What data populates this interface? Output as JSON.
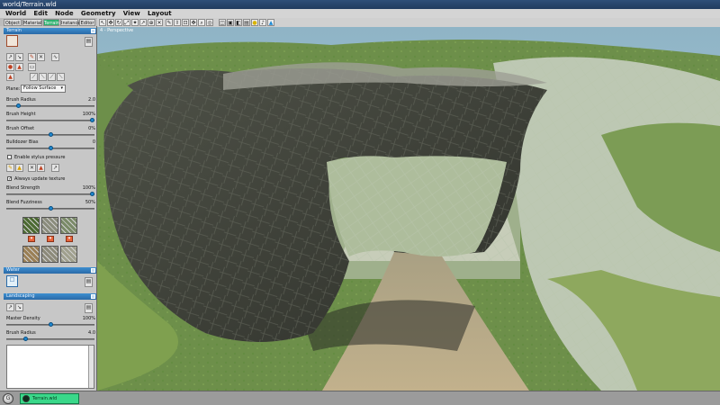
{
  "window": {
    "title": "world/Terrain.wld"
  },
  "menu": [
    "World",
    "Edit",
    "Node",
    "Geometry",
    "View",
    "Layout"
  ],
  "tabs": [
    "Object",
    "Material",
    "Terrain",
    "Instance",
    "Editor"
  ],
  "active_tab": "Terrain",
  "toolbar": {
    "icons": [
      "select-icon",
      "move-icon",
      "rotate-icon",
      "scale-icon",
      "magic-icon",
      "pointer-icon",
      "zoom-icon",
      "link-icon",
      "paint-icon",
      "scroll-icon",
      "camera-icon",
      "pan-icon",
      "zoom-icon",
      "orbit-icon",
      "fov-icon",
      "frame-icon",
      "cube-icon",
      "box-icon",
      "light-icon",
      "sound-icon",
      "marker-icon"
    ],
    "glyphs": [
      "↖",
      "✥",
      "↻",
      "⤢",
      "✦",
      "↗",
      "⊕",
      "✕",
      "✎",
      "⇳",
      "⊡",
      "✥",
      "⌕",
      "◎",
      "◫",
      "▣",
      "◧",
      "▤",
      "●",
      "♪",
      "▲"
    ]
  },
  "left_panel": {
    "terrain": {
      "header": "Terrain",
      "plane_label": "Plane:",
      "plane_value": "Follow Surface",
      "brush_radius": {
        "label": "Brush Radius",
        "value": "2.0",
        "level": 0.12
      },
      "brush_height": {
        "label": "Brush Height",
        "value": "100%",
        "level": 1.0
      },
      "brush_offset": {
        "label": "Brush Offset",
        "value": "0%",
        "level": 0.5
      },
      "bulldozer_bias": {
        "label": "Bulldozer Bias",
        "value": "0",
        "level": 0.5
      },
      "enable_stylus": {
        "label": "Enable stylus pressure",
        "checked": false
      },
      "always_update": {
        "label": "Always update texture",
        "checked": true
      },
      "blend_strength": {
        "label": "Blend Strength",
        "value": "100%",
        "level": 1.0
      },
      "blend_fuzziness": {
        "label": "Blend Fuzziness",
        "value": "50%",
        "level": 0.5
      },
      "textures": [
        "#4c6a32",
        "#8a8c7c",
        "#7a8a68",
        "#9a7f55",
        "#8c8a7a",
        "#a0a08e"
      ]
    },
    "water": {
      "header": "Water"
    },
    "landscaping": {
      "header": "Landscaping",
      "master_density": {
        "label": "Master Density",
        "value": "100%",
        "level": 0.5
      },
      "brush_radius": {
        "label": "Brush Radius",
        "value": "4.0",
        "level": 0.2
      }
    }
  },
  "viewport": {
    "label": "4 - Perspective"
  },
  "statusbar": {
    "task": "Terrain.wld"
  },
  "colors": {
    "accent": "#2bb06d",
    "panel_header": "#2a6aa8",
    "slider_knob": "#1e88d0"
  }
}
